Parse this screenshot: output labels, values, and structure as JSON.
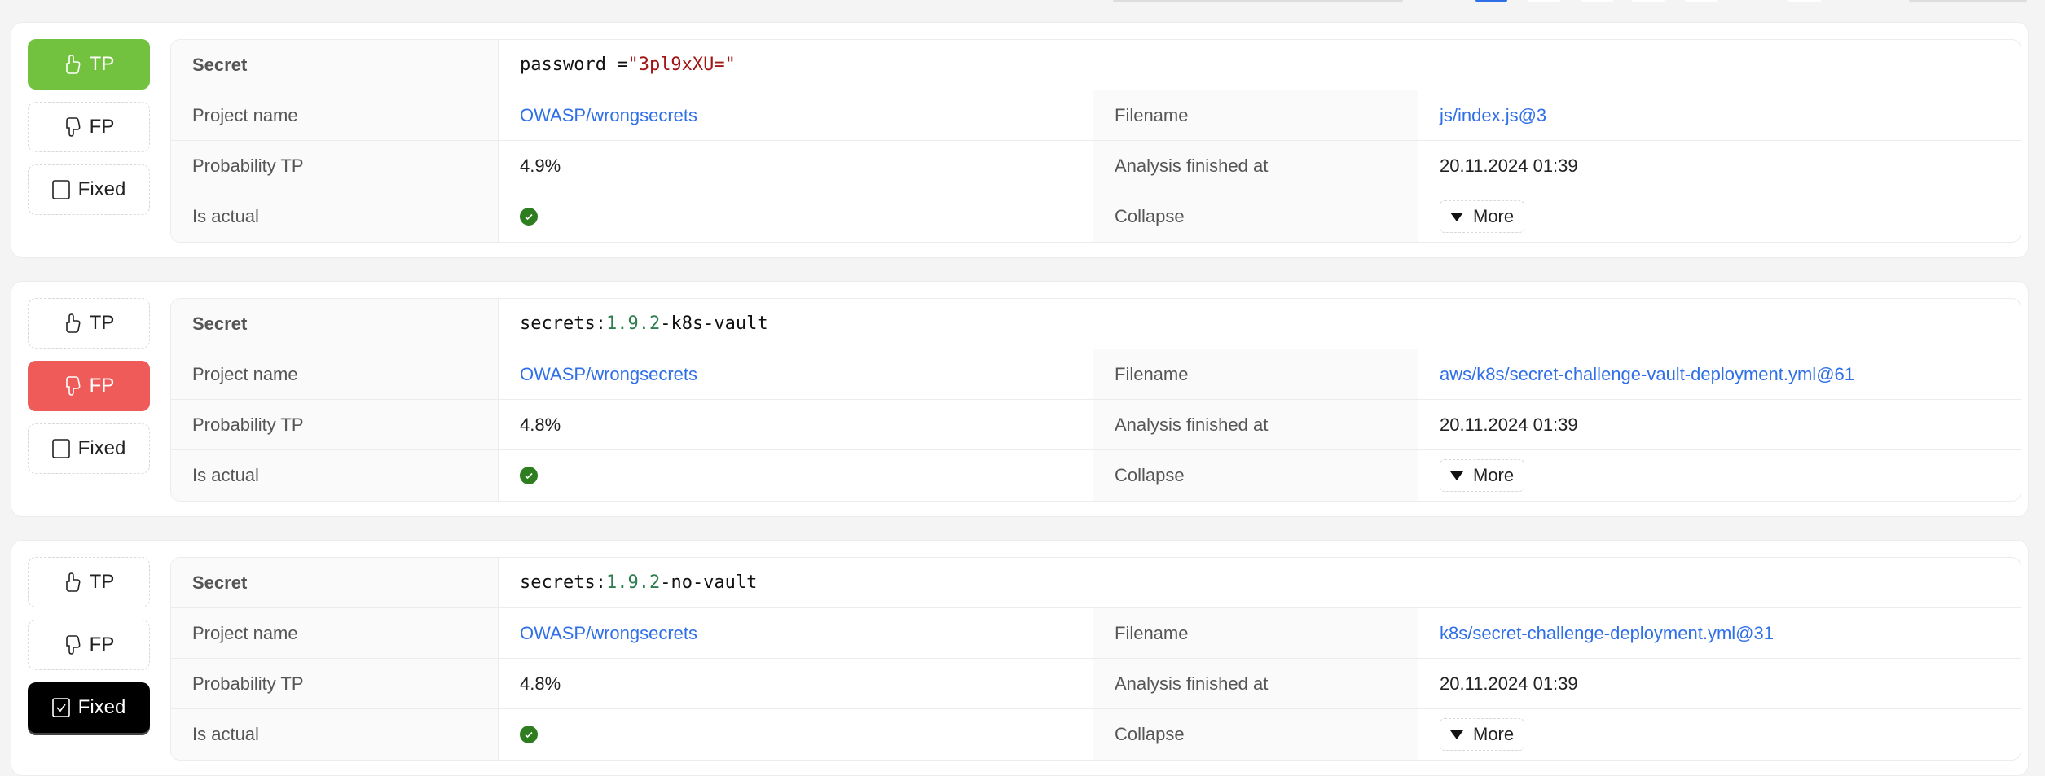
{
  "labels": {
    "secret": "Secret",
    "project_name": "Project name",
    "filename": "Filename",
    "probability": "Probability TP",
    "analysis": "Analysis finished at",
    "is_actual": "Is actual",
    "collapse": "Collapse",
    "more": "More",
    "tp": "TP",
    "fp": "FP",
    "fixed": "Fixed"
  },
  "colors": {
    "tp_active": "#73c23f",
    "fp_active": "#ee5b58",
    "fixed_active": "#000000",
    "link": "#2f6fe8",
    "string": "#a31515",
    "number": "#2e7d4f",
    "check": "#2e7d1f"
  },
  "cards": [
    {
      "state": "tp",
      "secret": [
        {
          "text": "password = ",
          "color": "#111111"
        },
        {
          "text": "\"3pl9xXU=\"",
          "color": "#a31515"
        }
      ],
      "project_name": "OWASP/wrongsecrets",
      "filename": "js/index.js@3",
      "probability": "4.9%",
      "analysis": "20.11.2024 01:39",
      "is_actual": true
    },
    {
      "state": "fp",
      "secret": [
        {
          "text": "secrets:",
          "color": "#111111"
        },
        {
          "text": "1.9.2",
          "color": "#2e7d4f"
        },
        {
          "text": "-k8s-vault",
          "color": "#111111"
        }
      ],
      "project_name": "OWASP/wrongsecrets",
      "filename": "aws/k8s/secret-challenge-vault-deployment.yml@61",
      "probability": "4.8%",
      "analysis": "20.11.2024 01:39",
      "is_actual": true
    },
    {
      "state": "fixed",
      "secret": [
        {
          "text": "secrets:",
          "color": "#111111"
        },
        {
          "text": "1.9.2",
          "color": "#2e7d4f"
        },
        {
          "text": "-no-vault",
          "color": "#111111"
        }
      ],
      "project_name": "OWASP/wrongsecrets",
      "filename": "k8s/secret-challenge-deployment.yml@31",
      "probability": "4.8%",
      "analysis": "20.11.2024 01:39",
      "is_actual": true
    }
  ]
}
